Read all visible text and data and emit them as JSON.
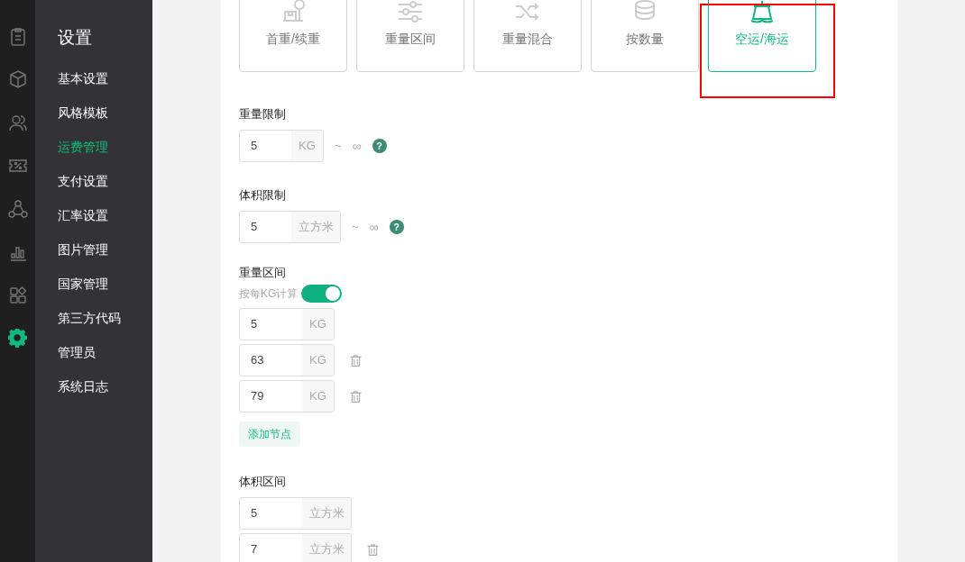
{
  "rail": [
    {
      "selected": false
    },
    {
      "selected": false
    },
    {
      "selected": false
    },
    {
      "selected": false
    },
    {
      "selected": false
    },
    {
      "selected": false
    },
    {
      "selected": false
    },
    {
      "selected": true
    }
  ],
  "sidebar": {
    "title": "设置",
    "items": [
      {
        "label": "基本设置",
        "selected": false
      },
      {
        "label": "风格模板",
        "selected": false
      },
      {
        "label": "运费管理",
        "selected": true
      },
      {
        "label": "支付设置",
        "selected": false
      },
      {
        "label": "汇率设置",
        "selected": false
      },
      {
        "label": "图片管理",
        "selected": false
      },
      {
        "label": "国家管理",
        "selected": false
      },
      {
        "label": "第三方代码",
        "selected": false
      },
      {
        "label": "管理员",
        "selected": false
      },
      {
        "label": "系统日志",
        "selected": false
      }
    ]
  },
  "mode_tabs": [
    {
      "label": "首重/续重",
      "selected": false,
      "highlighted": false
    },
    {
      "label": "重量区间",
      "selected": false,
      "highlighted": false
    },
    {
      "label": "重量混合",
      "selected": false,
      "highlighted": false
    },
    {
      "label": "按数量",
      "selected": false,
      "highlighted": false
    },
    {
      "label": "空运/海运",
      "selected": true,
      "highlighted": true
    }
  ],
  "limits": [
    {
      "label": "重量限制",
      "value": "5",
      "unit": "KG",
      "tilde": "~",
      "infinity": "∞",
      "help": "?"
    },
    {
      "label": "体积限制",
      "value": "5",
      "unit": "立方米",
      "tilde": "~",
      "infinity": "∞",
      "help": "?"
    }
  ],
  "weight_ranges": {
    "label": "重量区间",
    "toggle_label": "按每KG计算",
    "toggle_on": true,
    "rows": [
      {
        "value": "5",
        "unit": "KG",
        "deletable": false
      },
      {
        "value": "63",
        "unit": "KG",
        "deletable": true
      },
      {
        "value": "79",
        "unit": "KG",
        "deletable": true
      }
    ],
    "add_button": "添加节点"
  },
  "volume_ranges": {
    "label": "体积区间",
    "rows": [
      {
        "value": "5",
        "unit": "立方米",
        "deletable": false
      },
      {
        "value": "7",
        "unit": "立方米",
        "deletable": true
      }
    ]
  }
}
